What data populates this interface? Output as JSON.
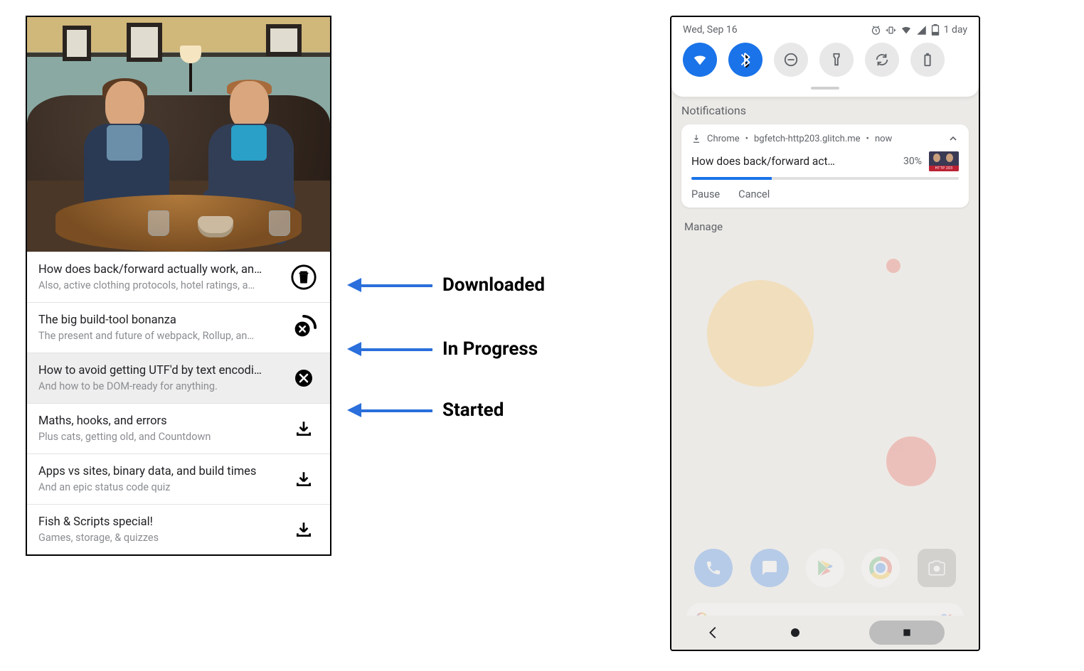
{
  "left": {
    "episodes": [
      {
        "title": "How does back/forward actually work, an…",
        "subtitle": "Also, active clothing protocols, hotel ratings, a…",
        "state": "downloaded",
        "selected": false
      },
      {
        "title": "The big build-tool bonanza",
        "subtitle": "The present and future of webpack, Rollup, an…",
        "state": "in-progress",
        "selected": false
      },
      {
        "title": "How to avoid getting UTF'd by text encodi…",
        "subtitle": "And how to be DOM-ready for anything.",
        "state": "started",
        "selected": true
      },
      {
        "title": "Maths, hooks, and errors",
        "subtitle": "Plus cats, getting old, and Countdown",
        "state": "not-downloaded",
        "selected": false
      },
      {
        "title": "Apps vs sites, binary data, and build times",
        "subtitle": "And an epic status code quiz",
        "state": "not-downloaded",
        "selected": false
      },
      {
        "title": "Fish & Scripts special!",
        "subtitle": "Games, storage, & quizzes",
        "state": "not-downloaded",
        "selected": false
      }
    ]
  },
  "annotations": [
    {
      "label": "Downloaded"
    },
    {
      "label": "In Progress"
    },
    {
      "label": "Started"
    }
  ],
  "right": {
    "status": {
      "date": "Wed, Sep 16",
      "battery_text": "1 day"
    },
    "quick_settings": [
      {
        "name": "wifi",
        "active": true
      },
      {
        "name": "bluetooth",
        "active": true
      },
      {
        "name": "dnd",
        "active": false
      },
      {
        "name": "flashlight",
        "active": false
      },
      {
        "name": "autorotate",
        "active": false
      },
      {
        "name": "battery-saver",
        "active": false
      }
    ],
    "notifications_heading": "Notifications",
    "notification": {
      "app": "Chrome",
      "source": "bgfetch-http203.glitch.me",
      "time": "now",
      "title": "How does back/forward act…",
      "percent_label": "30%",
      "percent_value": 30,
      "actions": {
        "pause": "Pause",
        "cancel": "Cancel"
      }
    },
    "manage_label": "Manage"
  }
}
